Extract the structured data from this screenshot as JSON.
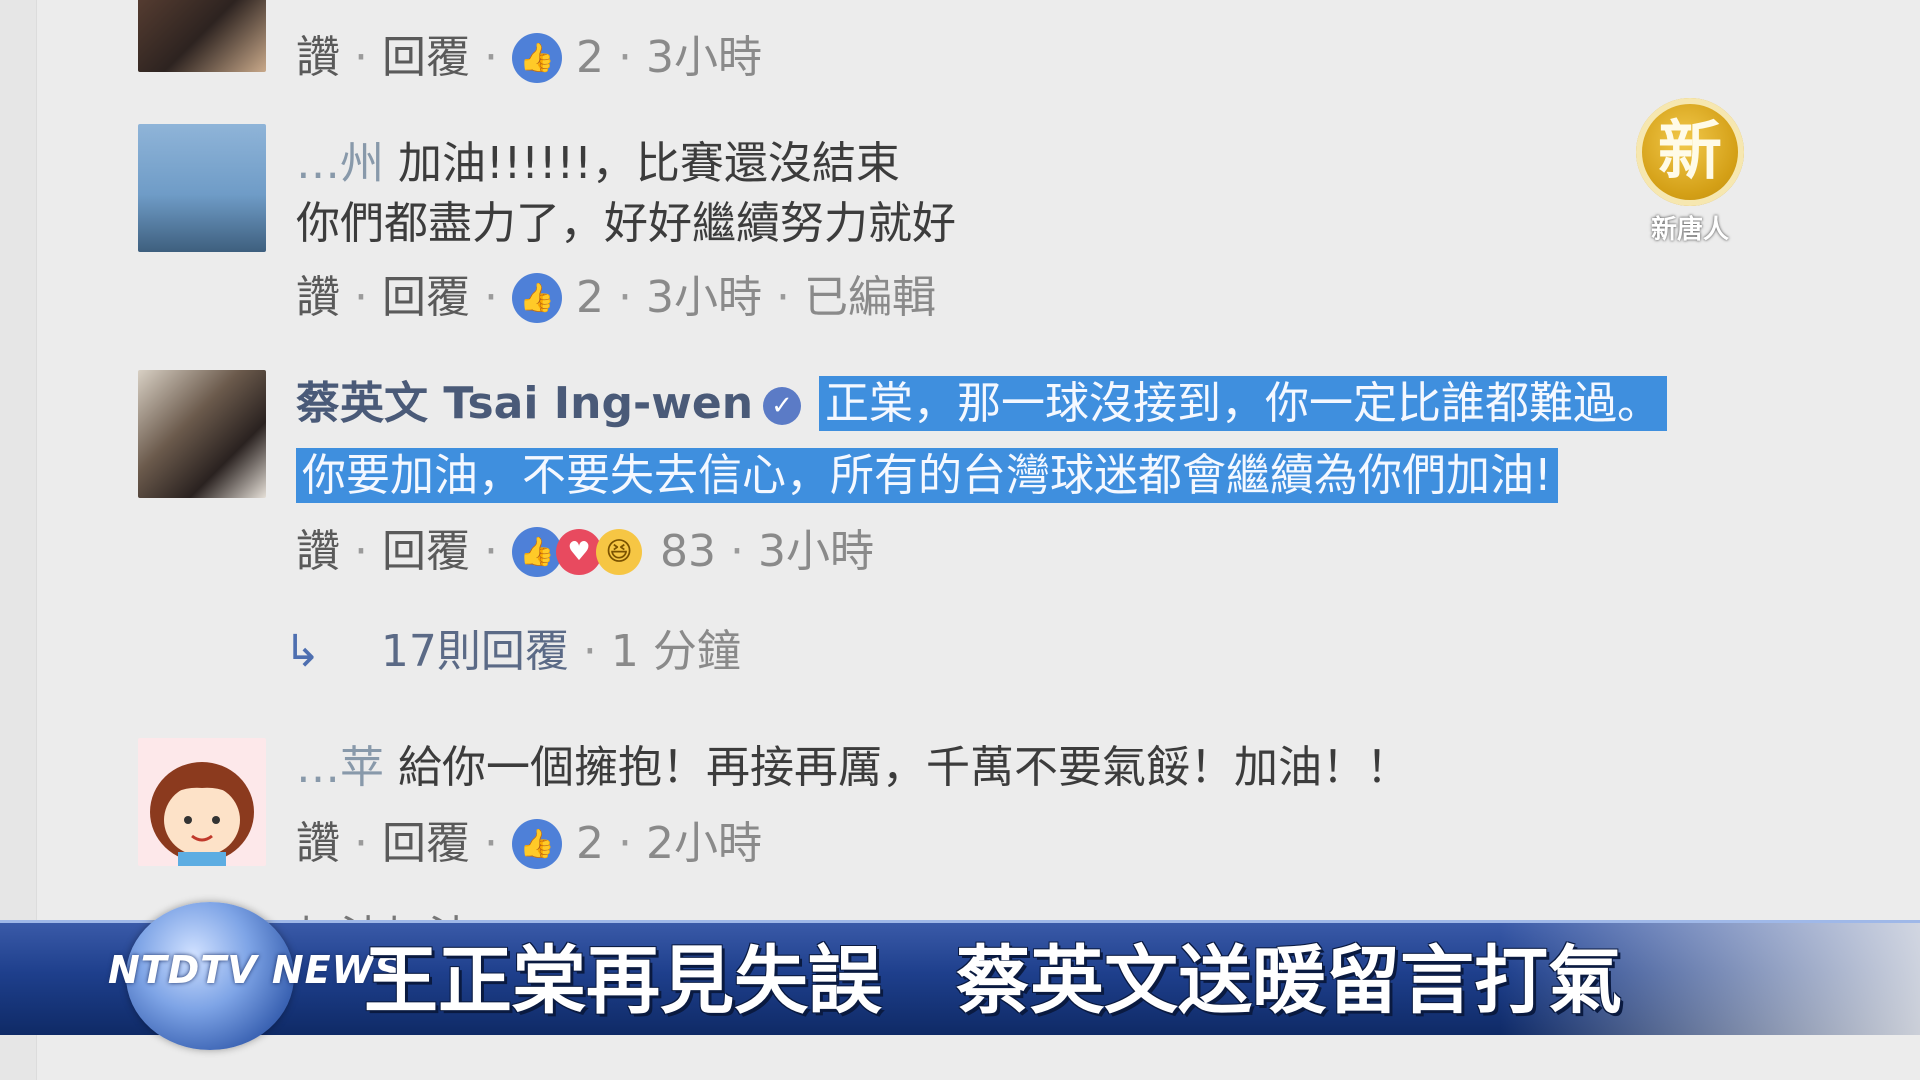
{
  "comments": [
    {
      "actions": {
        "like": "讚",
        "reply": "回覆",
        "likes": "2",
        "time": "3小時"
      }
    },
    {
      "author_blurred": "…州",
      "text_line1": "加油!!!!!!，比賽還沒結束",
      "text_line2": "你們都盡力了，好好繼續努力就好",
      "actions": {
        "like": "讚",
        "reply": "回覆",
        "likes": "2",
        "time": "3小時",
        "edited": "已編輯"
      }
    },
    {
      "author": "蔡英文 Tsai Ing-wen",
      "verified_icon": "check-icon",
      "text_line1": "正棠，那一球沒接到，你一定比誰都難過。",
      "text_line2": "你要加油，不要失去信心，所有的台灣球迷都會繼續為你們加油!",
      "actions": {
        "like": "讚",
        "reply": "回覆",
        "reactions": "83",
        "time": "3小時"
      },
      "replies": {
        "label": "17則回覆",
        "time": "1 分鐘"
      }
    },
    {
      "author_blurred": "…苹",
      "text_line1": "給你一個擁抱！再接再厲，千萬不要氣餒！加油！！",
      "actions": {
        "like": "讚",
        "reply": "回覆",
        "likes": "2",
        "time": "2小時"
      }
    }
  ],
  "next_comment_partial": "加油加油",
  "logo": {
    "glyph": "新",
    "text": "新唐人"
  },
  "news_bar": {
    "brand": "NTDTV NEWS",
    "headline": "王正棠再見失誤　蔡英文送暖留言打氣"
  },
  "colors": {
    "highlight": "#3f8fde",
    "like_blue": "#4e80d8",
    "bar_blue": "#1e3f8c"
  }
}
